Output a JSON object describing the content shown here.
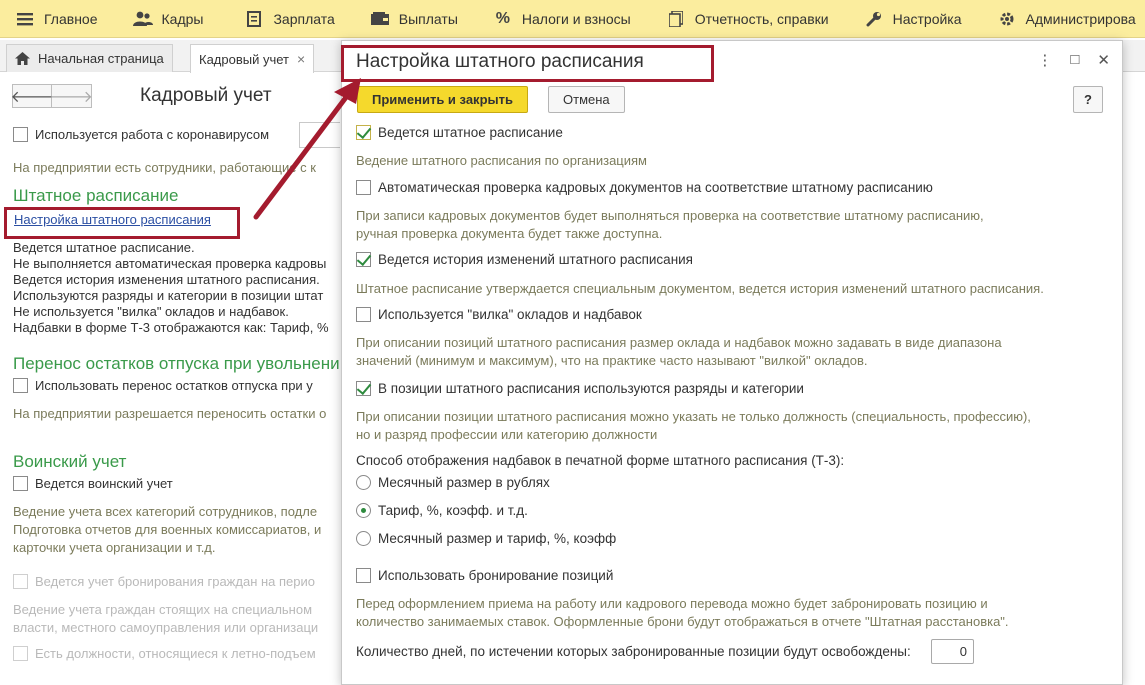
{
  "menu": {
    "items": [
      {
        "label": "Главное",
        "icon": "hamburger-icon"
      },
      {
        "label": "Кадры",
        "icon": "people-icon"
      },
      {
        "label": "Зарплата",
        "icon": "document-icon"
      },
      {
        "label": "Выплаты",
        "icon": "wallet-icon"
      },
      {
        "label": "Налоги и взносы",
        "icon": "percent-icon"
      },
      {
        "label": "Отчетность, справки",
        "icon": "report-icon"
      },
      {
        "label": "Настройка",
        "icon": "wrench-icon"
      },
      {
        "label": "Администрирова",
        "icon": "gear-icon"
      }
    ]
  },
  "tabs": {
    "home": "Начальная страница",
    "active": "Кадровый учет",
    "close": "×"
  },
  "bg": {
    "title": "Кадровый учет",
    "corona_label": "Используется работа с коронавирусом",
    "corona_hint": "На предприятии есть сотрудники, работающие с к",
    "staff_heading": "Штатное расписание",
    "staff_link": "Настройка штатного расписания",
    "staff_lines": [
      "Ведется штатное расписание.",
      "Не выполняется автоматическая проверка кадровы",
      "Ведется история изменения штатного расписания.",
      "Используются разряды и категории в позиции штат",
      "Не используется \"вилка\" окладов и надбавок.",
      "Надбавки в форме Т-3 отображаются как: Тариф, %"
    ],
    "vacation_heading": "Перенос остатков отпуска при увольнении",
    "vacation_label": "Использовать перенос остатков отпуска при у",
    "vacation_hint": "На предприятии разрешается переносить остатки о",
    "military_heading": "Воинский учет",
    "military_label": "Ведется воинский учет",
    "military_hint": [
      "Ведение учета всех категорий сотрудников, подле",
      "Подготовка отчетов для военных комиссариатов, и",
      "карточки учета организации и т.д."
    ],
    "booking_label": "Ведется учет бронирования граждан на перио",
    "booking_hint": [
      "Ведение учета граждан стоящих на специальном",
      "власти, местного самоуправления или организаци"
    ],
    "hazard_label": "Есть должности, относящиеся к летно-подъем"
  },
  "dialog": {
    "title": "Настройка штатного расписания",
    "more_icon": "⋮",
    "maximize_icon": "□",
    "close_icon": "✕",
    "apply_button": "Применить и закрыть",
    "cancel_button": "Отмена",
    "help_button": "?",
    "options": {
      "staffing": {
        "label": "Ведется штатное расписание",
        "checked": true
      },
      "staffing_hint": "Ведение штатного расписания по организациям",
      "auto_check": {
        "label": "Автоматическая проверка кадровых документов на соответствие штатному расписанию",
        "checked": false
      },
      "auto_check_hint": [
        "При записи кадровых документов будет выполняться проверка на соответствие штатному расписанию,",
        "ручная проверка документа будет также доступна."
      ],
      "history": {
        "label": "Ведется история изменений штатного расписания",
        "checked": true
      },
      "history_hint": "Штатное расписание утверждается специальным документом, ведется история изменений штатного расписания.",
      "fork": {
        "label": "Используется \"вилка\" окладов и надбавок",
        "checked": false
      },
      "fork_hint": [
        "При описании позиций штатного расписания размер оклада и надбавок можно задавать в виде диапазона",
        "значений (минимум и максимум), что на практике часто называют \"вилкой\" окладов."
      ],
      "grades": {
        "label": "В позиции штатного расписания используются разряды и категории",
        "checked": true
      },
      "grades_hint": [
        "При описании позиции штатного расписания можно указать не только должность (специальность, профессию),",
        "но и разряд профессии или категорию должности"
      ],
      "display_caption": "Способ отображения надбавок в печатной форме штатного расписания (Т-3):",
      "display_options": [
        {
          "label": "Месячный размер в рублях",
          "selected": false
        },
        {
          "label": "Тариф, %, коэфф. и т.д.",
          "selected": true
        },
        {
          "label": "Месячный размер и тариф, %, коэфф",
          "selected": false
        }
      ],
      "booking": {
        "label": "Использовать бронирование позиций",
        "checked": false
      },
      "booking_hint": [
        "Перед оформлением приема на работу или кадрового перевода можно будет забронировать позицию и",
        "количество занимаемых ставок. Оформленные брони будут отображаться в отчете \"Штатная расстановка\"."
      ],
      "days_label": "Количество дней, по истечении которых забронированные позиции будут освобождены:",
      "days_value": "0"
    }
  },
  "colors": {
    "menu_bg": "#fbed9e",
    "accent_green": "#3a9a4a",
    "annotation_red": "#a41b2e",
    "primary_button": "#f5d92c",
    "hint_text": "#7b7b5b",
    "link": "#2b4fa3"
  }
}
